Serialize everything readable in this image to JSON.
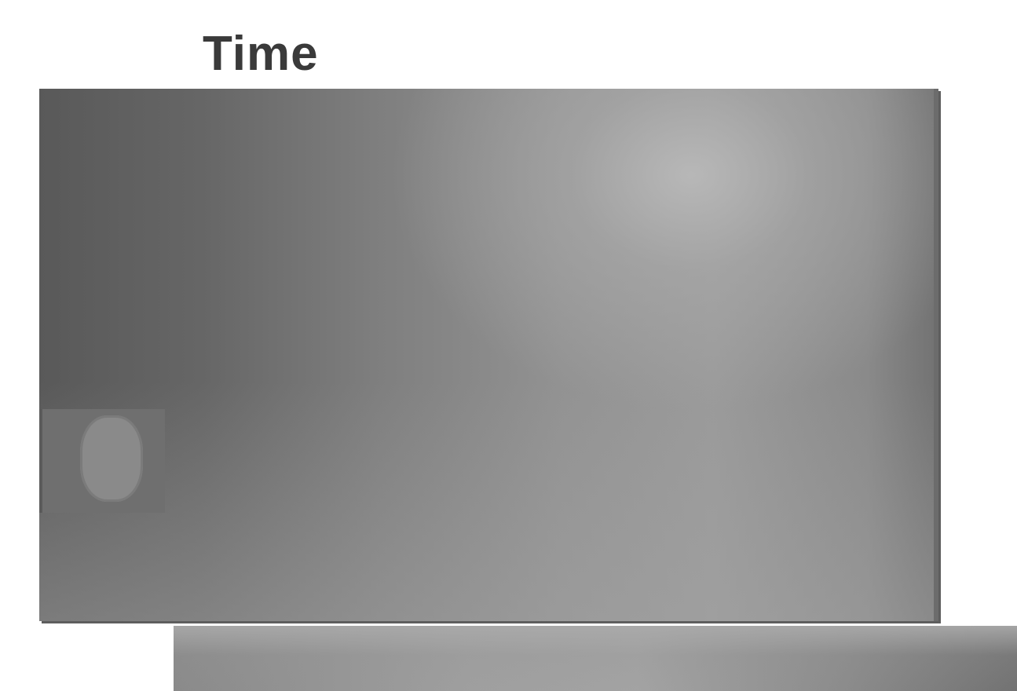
{
  "title": "Time",
  "time_display": {
    "digit": "0"
  },
  "colors": {
    "title_text": "#3a3a3a",
    "screen_dark": "#595959",
    "screen_light": "#b9b9b9",
    "digit_box": "#6f6f6f",
    "digit_shape": "#8a8a8a",
    "background": "#ffffff"
  }
}
